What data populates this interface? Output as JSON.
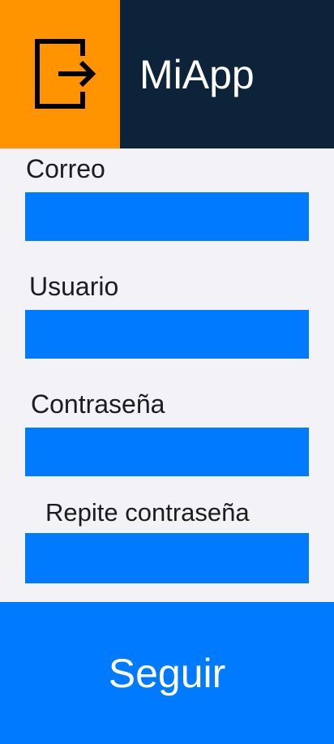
{
  "header": {
    "app_title": "MiApp",
    "logo_icon": "sign-out-arrow-icon",
    "logo_color": "#ff9300",
    "background_color": "#0d2339"
  },
  "form": {
    "email": {
      "label": "Correo",
      "value": ""
    },
    "username": {
      "label": "Usuario",
      "value": ""
    },
    "password": {
      "label": "Contraseña",
      "value": ""
    },
    "repeat_password": {
      "label": "Repite contraseña",
      "value": ""
    }
  },
  "submit": {
    "label": "Seguir",
    "color": "#007aff"
  }
}
